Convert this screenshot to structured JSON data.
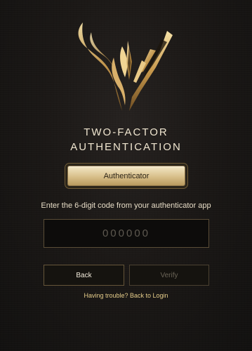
{
  "title": {
    "line1": "TWO-FACTOR",
    "line2": "AUTHENTICATION"
  },
  "mode": {
    "label": "Authenticator"
  },
  "prompt": "Enter the 6-digit code from your authenticator app",
  "code_input": {
    "value": "",
    "placeholder": "000000"
  },
  "buttons": {
    "back": "Back",
    "verify": "Verify"
  },
  "help": {
    "text": "Having trouble? Back to Login"
  },
  "icons": {
    "logo": "winged-crest-logo"
  },
  "colors": {
    "accent_gold": "#d8bf8a",
    "background": "#1b1816"
  }
}
